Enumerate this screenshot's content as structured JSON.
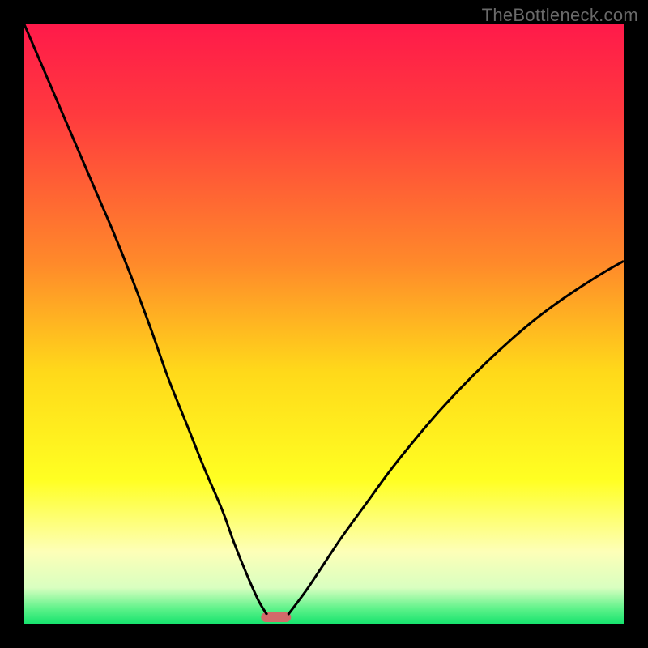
{
  "watermark": "TheBottleneck.com",
  "chart_data": {
    "type": "line",
    "title": "",
    "xlabel": "",
    "ylabel": "",
    "xlim": [
      0,
      100
    ],
    "ylim": [
      0,
      100
    ],
    "series": [
      {
        "name": "left-curve",
        "x": [
          0,
          3,
          6,
          9,
          12,
          15,
          18,
          21,
          24,
          27,
          30,
          33,
          35,
          37,
          39,
          40.5
        ],
        "y": [
          100,
          93,
          86,
          79,
          72,
          65,
          57.5,
          49.5,
          41,
          33.5,
          26,
          19,
          13.5,
          8.5,
          4,
          1.5
        ]
      },
      {
        "name": "right-curve",
        "x": [
          44,
          47,
          50,
          53,
          57,
          61,
          65,
          69,
          73,
          77,
          81,
          85,
          89,
          93,
          97,
          100
        ],
        "y": [
          1.5,
          5.5,
          10,
          14.5,
          20,
          25.5,
          30.5,
          35.2,
          39.5,
          43.5,
          47.2,
          50.6,
          53.6,
          56.3,
          58.8,
          60.5
        ]
      }
    ],
    "marker": {
      "name": "bottleneck-marker",
      "x": 42,
      "width": 5,
      "color": "#d36a6a"
    },
    "gradient_stops": [
      {
        "offset": 0.0,
        "color": "#ff1a4a"
      },
      {
        "offset": 0.15,
        "color": "#ff3a3e"
      },
      {
        "offset": 0.4,
        "color": "#ff8a2a"
      },
      {
        "offset": 0.58,
        "color": "#ffd91a"
      },
      {
        "offset": 0.76,
        "color": "#ffff22"
      },
      {
        "offset": 0.88,
        "color": "#fdffb8"
      },
      {
        "offset": 0.94,
        "color": "#d9ffc0"
      },
      {
        "offset": 0.975,
        "color": "#5ef28a"
      },
      {
        "offset": 1.0,
        "color": "#17e36e"
      }
    ]
  }
}
